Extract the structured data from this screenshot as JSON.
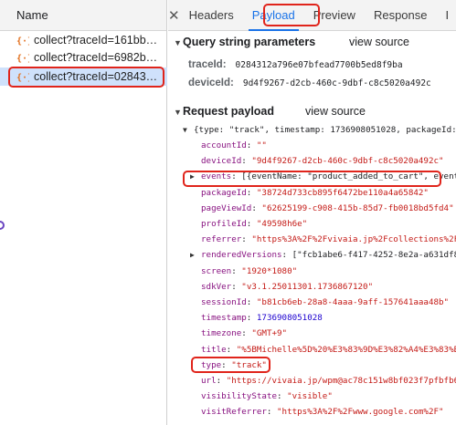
{
  "left_panel": {
    "header": "Name",
    "requests": [
      {
        "name": "collect?traceId=161bb…",
        "selected": false
      },
      {
        "name": "collect?traceId=6982b…",
        "selected": false
      },
      {
        "name": "collect?traceId=02843…",
        "selected": true
      }
    ],
    "icon": "xhr-request-icon"
  },
  "tabs": {
    "close": "✕",
    "items": [
      "Headers",
      "Payload",
      "Preview",
      "Response",
      "I"
    ],
    "active": "Payload"
  },
  "query": {
    "title": "Query string parameters",
    "view_source": "view source",
    "params": [
      {
        "key": "traceId:",
        "value": "0284312a796e07bfead7700b5ed8f9ba"
      },
      {
        "key": "deviceId:",
        "value": "9d4f9267-d2cb-460c-9dbf-c8c5020a492c"
      }
    ]
  },
  "payload": {
    "title": "Request payload",
    "view_source": "view source",
    "summary": "{type: \"track\", timestamp: 1736908051028, packageId:",
    "fields": [
      {
        "key": "accountId",
        "value": "\"\"",
        "kind": "str"
      },
      {
        "key": "deviceId",
        "value": "\"9d4f9267-d2cb-460c-9dbf-c8c5020a492c\"",
        "kind": "str"
      },
      {
        "key": "events",
        "value": "[{eventName: \"product_added_to_cart\", event",
        "kind": "obj",
        "expandable": true
      },
      {
        "key": "packageId",
        "value": "\"38724d733cb895f6472be110a4a65842\"",
        "kind": "str"
      },
      {
        "key": "pageViewId",
        "value": "\"62625199-c908-415b-85d7-fb0018bd5fd4\"",
        "kind": "str"
      },
      {
        "key": "profileId",
        "value": "\"49598h6e\"",
        "kind": "str"
      },
      {
        "key": "referrer",
        "value": "\"https%3A%2F%2Fvivaia.jp%2Fcollections%2Fn",
        "kind": "str"
      },
      {
        "key": "renderedVersions",
        "value": "[\"fcb1abe6-f417-4252-8e2a-a631df8",
        "kind": "obj",
        "expandable": true
      },
      {
        "key": "screen",
        "value": "\"1920*1080\"",
        "kind": "str"
      },
      {
        "key": "sdkVer",
        "value": "\"v3.1.25011301.1736867120\"",
        "kind": "str"
      },
      {
        "key": "sessionId",
        "value": "\"b81cb6eb-28a8-4aaa-9aff-157641aaa48b\"",
        "kind": "str"
      },
      {
        "key": "timestamp",
        "value": "1736908051028",
        "kind": "num"
      },
      {
        "key": "timezone",
        "value": "\"GMT+9\"",
        "kind": "str"
      },
      {
        "key": "title",
        "value": "\"%5BMichelle%5D%20%E3%83%9D%E3%82%A4%E3%83%B3",
        "kind": "str"
      },
      {
        "key": "type",
        "value": "\"track\"",
        "kind": "str"
      },
      {
        "key": "url",
        "value": "\"https://vivaia.jp/wpm@ac78c151w8bf023f7pfbfb60",
        "kind": "str"
      },
      {
        "key": "visibilityState",
        "value": "\"visible\"",
        "kind": "str"
      },
      {
        "key": "visitReferrer",
        "value": "\"https%3A%2F%2Fwww.google.com%2F\"",
        "kind": "str"
      }
    ]
  },
  "colors": {
    "highlight": "#e0241b",
    "selected_row": "#cfe1fb",
    "key": "#881280",
    "string": "#c41a16",
    "number": "#1c00cf"
  }
}
